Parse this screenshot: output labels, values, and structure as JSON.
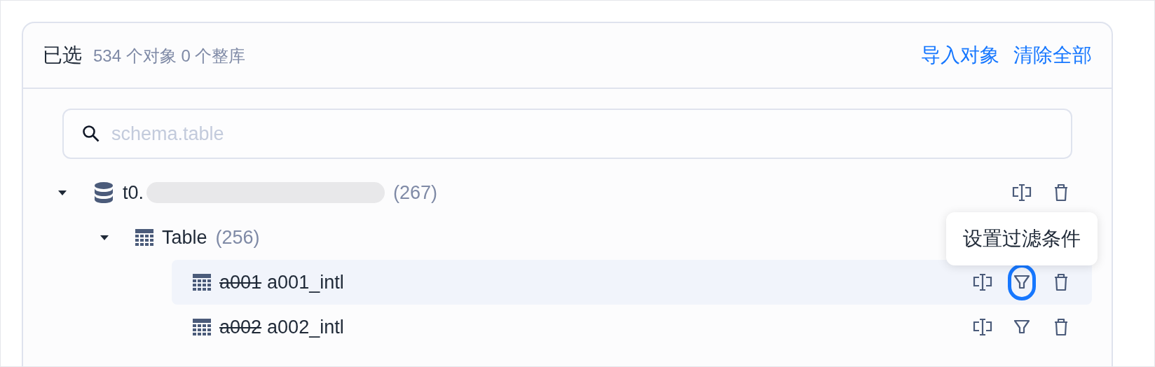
{
  "header": {
    "title": "已选",
    "summary": "534 个对象 0 个整库",
    "links": [
      "导入对象",
      "清除全部"
    ]
  },
  "search": {
    "placeholder": "schema.table"
  },
  "tree": [
    {
      "kind": "database",
      "name": "t0.",
      "redacted": true,
      "count": "(267)",
      "expanded": true,
      "selected": false,
      "actions": [
        {
          "kind": "rename",
          "highlighted": false
        },
        {
          "kind": "delete",
          "highlighted": false
        }
      ],
      "children": [
        {
          "kind": "group",
          "name": "Table",
          "count": "(256)",
          "expanded": true,
          "selected": false,
          "children": [
            {
              "kind": "table",
              "old_name": "a001",
              "name": "a001_intl",
              "selected": true,
              "tooltip": "设置过滤条件",
              "actions": [
                {
                  "kind": "rename",
                  "highlighted": false
                },
                {
                  "kind": "filter",
                  "highlighted": true
                },
                {
                  "kind": "delete",
                  "highlighted": false
                }
              ]
            },
            {
              "kind": "table",
              "old_name": "a002",
              "name": "a002_intl",
              "selected": false,
              "actions": [
                {
                  "kind": "rename",
                  "highlighted": false
                },
                {
                  "kind": "filter",
                  "highlighted": false
                },
                {
                  "kind": "delete",
                  "highlighted": false
                }
              ]
            }
          ]
        }
      ]
    }
  ]
}
